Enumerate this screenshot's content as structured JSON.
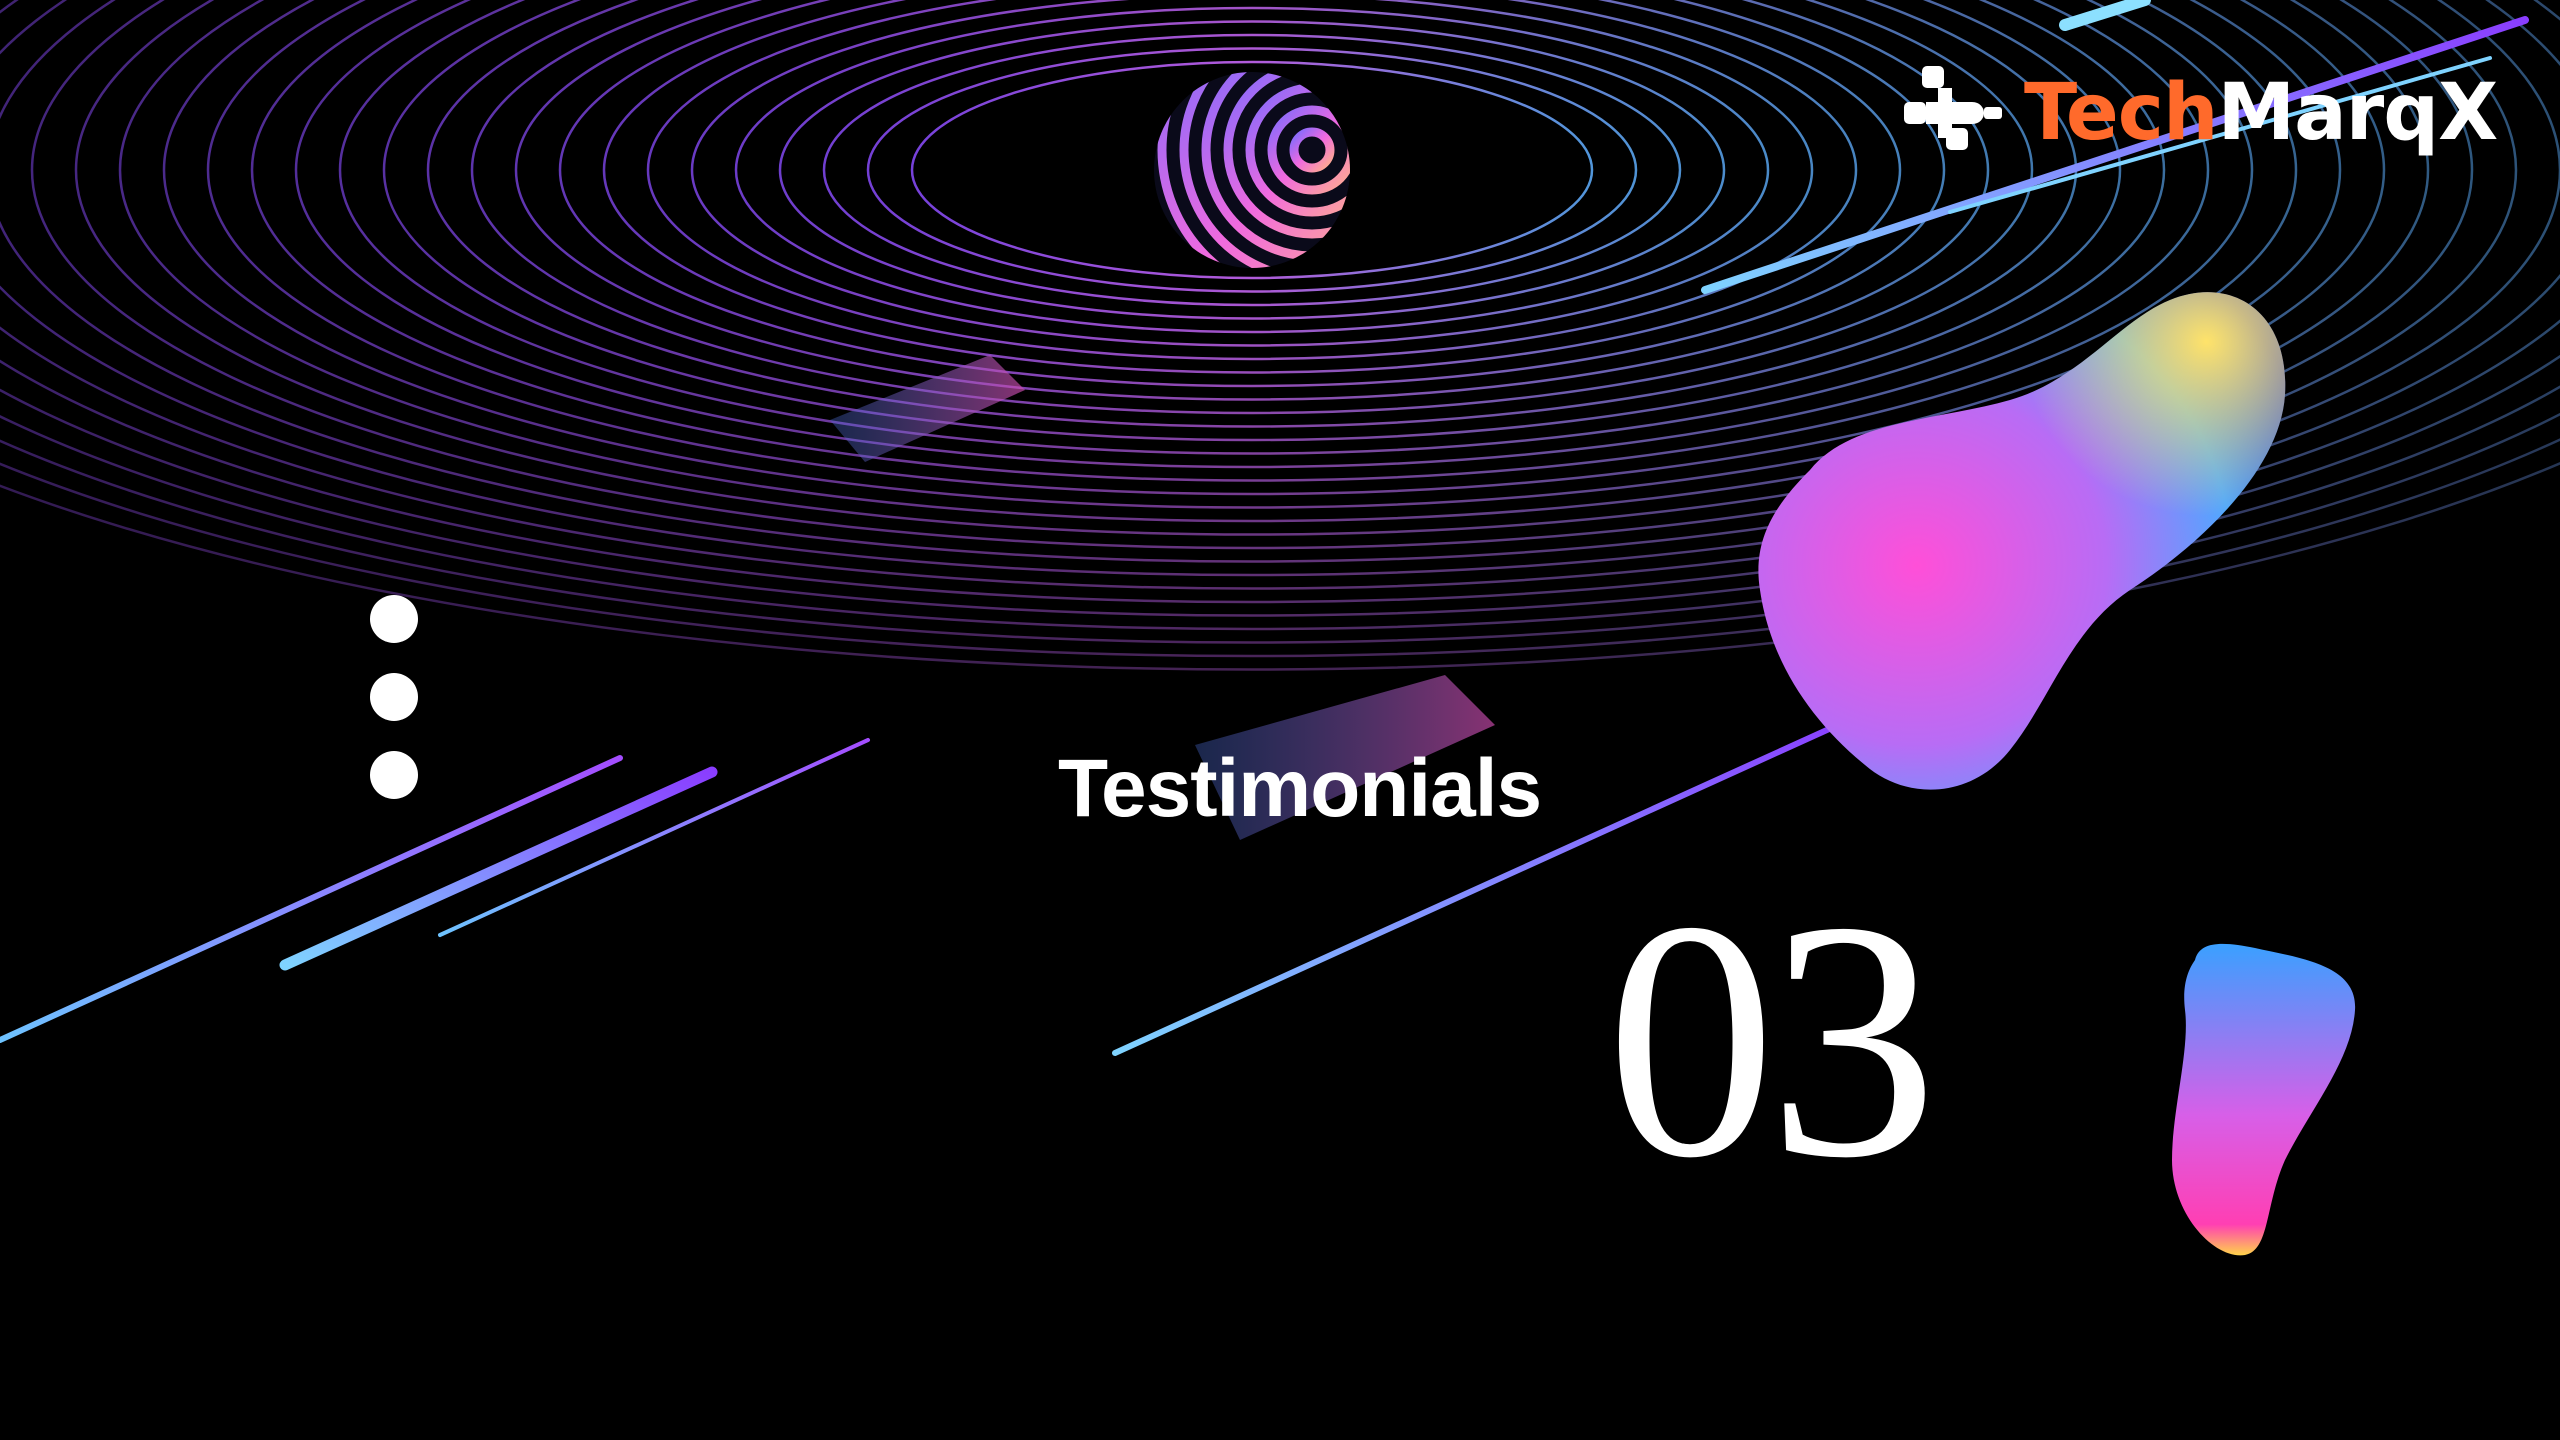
{
  "slide": {
    "section_title": "Testimonials",
    "section_number": "03"
  },
  "brand": {
    "name_part1": "Tech",
    "name_part2": "MarqX",
    "accent_color": "#ff6a2b",
    "text_color": "#ffffff"
  },
  "decor": {
    "background_color": "#000000",
    "dot_icons": [
      "dot-icon",
      "dot-icon",
      "dot-icon"
    ]
  }
}
